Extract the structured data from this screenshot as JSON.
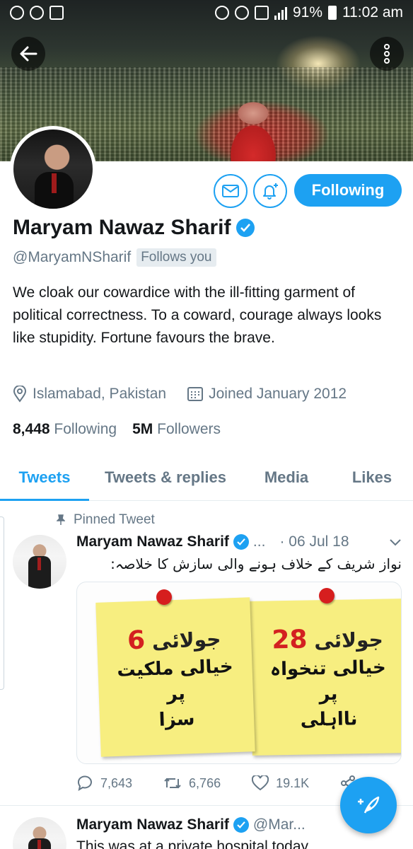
{
  "status_bar": {
    "battery": "91%",
    "time": "11:02 am"
  },
  "profile": {
    "name": "Maryam Nawaz Sharif",
    "handle": "@MaryamNSharif",
    "follows_you": "Follows you",
    "follow_button": "Following",
    "bio": "We cloak our cowardice with the ill-fitting garment of political correctness. To a coward, courage always looks like stupidity. Fortune favours the brave.",
    "location": "Islamabad, Pakistan",
    "joined": "Joined January 2012",
    "following_count": "8,448",
    "following_label": "Following",
    "followers_count": "5M",
    "followers_label": "Followers"
  },
  "tabs": [
    {
      "label": "Tweets",
      "active": true
    },
    {
      "label": "Tweets & replies",
      "active": false
    },
    {
      "label": "Media",
      "active": false
    },
    {
      "label": "Likes",
      "active": false
    }
  ],
  "pinned_tweet": {
    "pinned_label": "Pinned Tweet",
    "author": "Maryam Nawaz Sharif",
    "handle_truncated": "...",
    "date": "· 06 Jul 18",
    "text": "نواز شریف کے خلاف ہونے والی سازش کا خلاصہ:",
    "notes": [
      {
        "number": "28",
        "line1": "جولائی",
        "line2": "خیالی تنخواہ",
        "line3": "پر",
        "line4": "نااہلی"
      },
      {
        "number": "6",
        "line1": "جولائی",
        "line2": "خیالی ملکیت",
        "line3": "پر",
        "line4": "سزا"
      }
    ],
    "replies": "7,643",
    "retweets": "6,766",
    "likes": "19.1K"
  },
  "second_tweet": {
    "author": "Maryam Nawaz Sharif",
    "handle_truncated": "@Mar...",
    "text": "This was at a private hospital today"
  },
  "colors": {
    "accent": "#1da1f2",
    "muted": "#657786",
    "text": "#14171a"
  }
}
